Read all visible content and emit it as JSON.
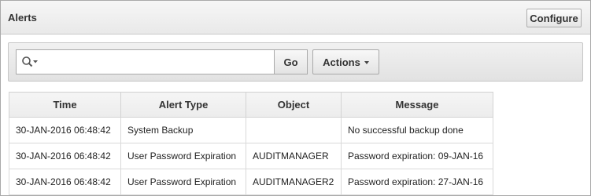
{
  "region": {
    "title": "Alerts",
    "configure_label": "Configure"
  },
  "toolbar": {
    "search_value": "",
    "search_icon": "search-icon",
    "go_label": "Go",
    "actions_label": "Actions"
  },
  "table": {
    "columns": [
      "Time",
      "Alert Type",
      "Object",
      "Message"
    ],
    "rows": [
      {
        "time": "30-JAN-2016 06:48:42",
        "alert_type": "System Backup",
        "object": "",
        "message": "No successful backup done"
      },
      {
        "time": "30-JAN-2016 06:48:42",
        "alert_type": "User Password Expiration",
        "object": "AUDITMANAGER",
        "message": "Password expiration: 09-JAN-16"
      },
      {
        "time": "30-JAN-2016 06:48:42",
        "alert_type": "User Password Expiration",
        "object": "AUDITMANAGER2",
        "message": "Password expiration: 27-JAN-16"
      }
    ]
  }
}
